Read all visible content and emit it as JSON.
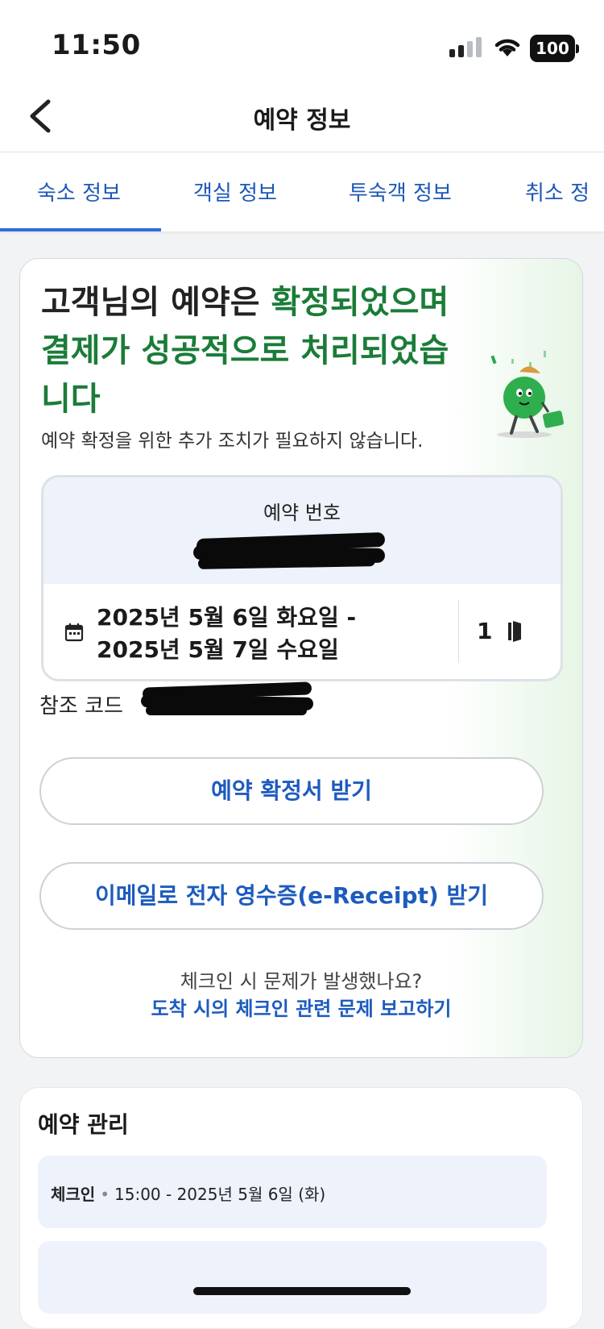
{
  "status_bar": {
    "time": "11:50",
    "battery": "100"
  },
  "nav": {
    "title": "예약 정보"
  },
  "tabs": [
    {
      "label": "숙소 정보",
      "active": true
    },
    {
      "label": "객실 정보"
    },
    {
      "label": "투숙객 정보"
    },
    {
      "label": "취소 정"
    }
  ],
  "confirmation": {
    "headline_part1": "고객님의 예약은 ",
    "headline_part2": "확정되었으며 결제가 성공적으로 처리되었습니다",
    "subline": "예약 확정을 위한 추가 조치가 필요하지 않습니다.",
    "reservation_label": "예약 번호",
    "date_line1": "2025년 5월 6일 화요일 -",
    "date_line2": "2025년 5월 7일 수요일",
    "rooms": "1",
    "reference_label": "참조 코드",
    "btn_confirmation": "예약 확정서 받기",
    "btn_receipt": "이메일로 전자 영수증(e-Receipt) 받기",
    "help_question": "체크인 시 문제가 발생했나요?",
    "help_link": "도착 시의 체크인 관련 문제 보고하기"
  },
  "manage": {
    "title": "예약 관리",
    "checkin_label": "체크인",
    "checkin_value": "15:00 - 2025년 5월 6일 (화)"
  },
  "colors": {
    "accent": "#1d5bbf",
    "confirm_green": "#1b7c38",
    "tab_underline": "#2e6ed9"
  }
}
